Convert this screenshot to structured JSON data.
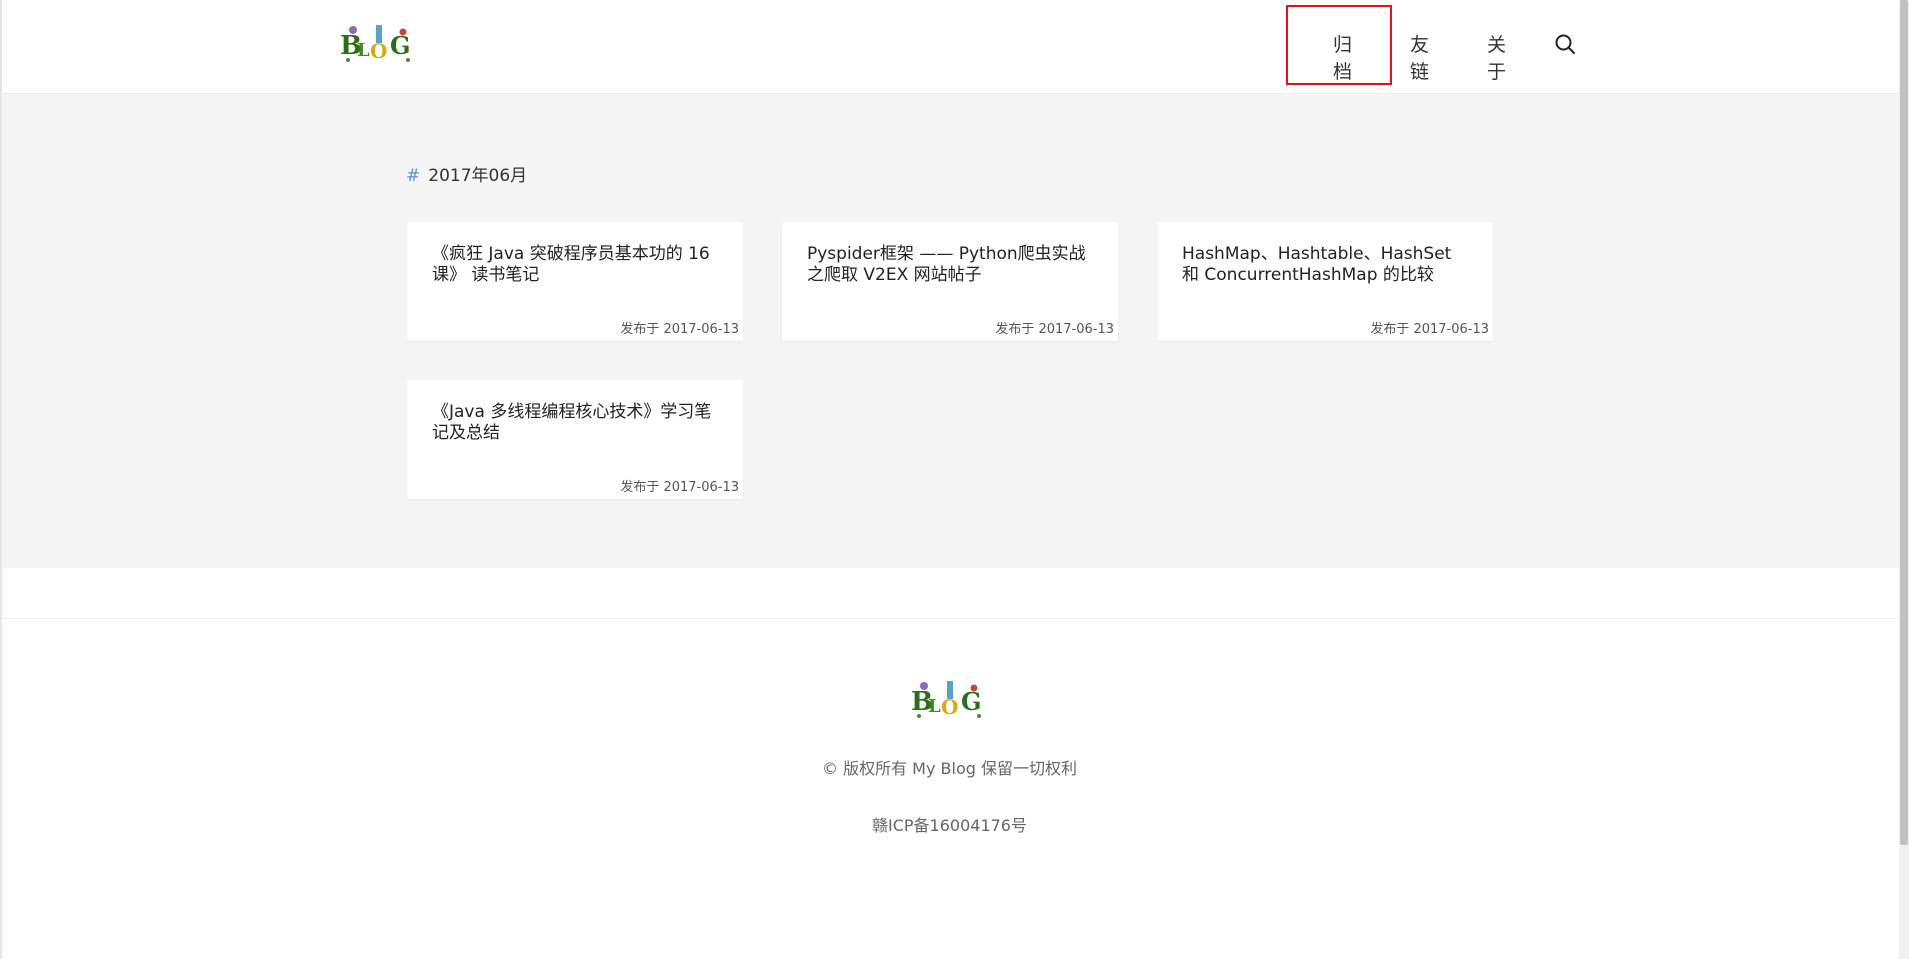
{
  "header": {
    "nav": {
      "archive": "归档",
      "links": "友链",
      "about": "关于"
    }
  },
  "archive": {
    "hash": "#",
    "month": "2017年06月",
    "posts": [
      {
        "title": "《疯狂 Java 突破程序员基本功的 16 课》 读书笔记",
        "date": "发布于 2017-06-13"
      },
      {
        "title": "Pyspider框架 —— Python爬虫实战之爬取 V2EX 网站帖子",
        "date": "发布于 2017-06-13"
      },
      {
        "title": "HashMap、Hashtable、HashSet 和 ConcurrentHashMap 的比较",
        "date": "发布于 2017-06-13"
      },
      {
        "title": "《Java 多线程编程核心技术》学习笔记及总结",
        "date": "发布于 2017-06-13"
      }
    ]
  },
  "footer": {
    "copyright": "© 版权所有 My Blog 保留一切权利",
    "icp": "赣ICP备16004176号"
  },
  "icons": {
    "logo": "blog-logo",
    "search": "search-icon"
  },
  "colors": {
    "accent": "#5b8fd6",
    "highlight": "#e0141b",
    "background": "#f5f5f5"
  }
}
